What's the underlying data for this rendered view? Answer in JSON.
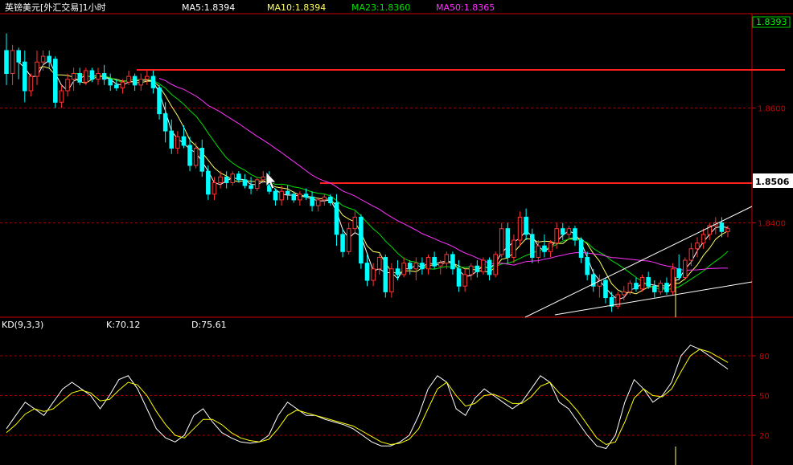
{
  "header": {
    "title": "英镑美元[外汇交易]1小时",
    "ma_labels": [
      {
        "text": "MA5:1.8394",
        "color": "#ffffff"
      },
      {
        "text": "MA10:1.8394",
        "color": "#ffff66"
      },
      {
        "text": "MA23:1.8360",
        "color": "#00e000"
      },
      {
        "text": "MA50:1.8365",
        "color": "#ff33ff"
      }
    ]
  },
  "kd_header": {
    "name": "KD(9,3,3)",
    "k_label": "K:70.12",
    "d_label": "D:75.61"
  },
  "price_axis": {
    "ticks": [
      "1.8600",
      "1.8400"
    ],
    "top_value": "1.8393",
    "highlight_value": "1.8506"
  },
  "kd_axis": {
    "ticks": [
      "80",
      "50",
      "20"
    ]
  },
  "colors": {
    "background": "#000000",
    "grid": "#990000",
    "axis": "#cc0000",
    "up_candle": "#ff3333",
    "down_candle": "#00ffff",
    "ma5": "#ffffff",
    "ma10": "#ffff66",
    "ma23": "#00e000",
    "ma50": "#ff33ff",
    "resistance": "#ff2020",
    "channel": "#ffffff",
    "k_line": "#ffffff",
    "d_line": "#ffff00"
  },
  "chart_data": [
    {
      "type": "candlestick",
      "title": "英镑美元[外汇交易]1小时",
      "ylim": [
        1.824,
        1.876
      ],
      "yticks": [
        1.86,
        1.84
      ],
      "candles": [
        [
          1.87,
          1.873,
          1.864,
          1.866
        ],
        [
          1.866,
          1.871,
          1.864,
          1.87
        ],
        [
          1.87,
          1.8705,
          1.865,
          1.868
        ],
        [
          1.868,
          1.87,
          1.861,
          1.863
        ],
        [
          1.863,
          1.866,
          1.862,
          1.8655
        ],
        [
          1.8655,
          1.87,
          1.864,
          1.868
        ],
        [
          1.868,
          1.87,
          1.8665,
          1.869
        ],
        [
          1.869,
          1.87,
          1.867,
          1.868
        ],
        [
          1.8685,
          1.869,
          1.86,
          1.861
        ],
        [
          1.861,
          1.864,
          1.86,
          1.863
        ],
        [
          1.863,
          1.866,
          1.862,
          1.865
        ],
        [
          1.865,
          1.867,
          1.863,
          1.866
        ],
        [
          1.866,
          1.867,
          1.864,
          1.8645
        ],
        [
          1.8645,
          1.867,
          1.864,
          1.8665
        ],
        [
          1.8665,
          1.867,
          1.8645,
          1.865
        ],
        [
          1.865,
          1.867,
          1.864,
          1.866
        ],
        [
          1.866,
          1.8675,
          1.864,
          1.865
        ],
        [
          1.865,
          1.866,
          1.863,
          1.864
        ],
        [
          1.864,
          1.865,
          1.863,
          1.8635
        ],
        [
          1.8635,
          1.865,
          1.8625,
          1.8645
        ],
        [
          1.8645,
          1.8665,
          1.864,
          1.8655
        ],
        [
          1.8655,
          1.866,
          1.863,
          1.864
        ],
        [
          1.864,
          1.866,
          1.863,
          1.865
        ],
        [
          1.865,
          1.8665,
          1.864,
          1.8655
        ],
        [
          1.8655,
          1.8665,
          1.8625,
          1.8635
        ],
        [
          1.8635,
          1.864,
          1.858,
          1.859
        ],
        [
          1.859,
          1.861,
          1.854,
          1.856
        ],
        [
          1.856,
          1.858,
          1.852,
          1.853
        ],
        [
          1.853,
          1.856,
          1.852,
          1.855
        ],
        [
          1.855,
          1.857,
          1.853,
          1.8535
        ],
        [
          1.8535,
          1.855,
          1.849,
          1.85
        ],
        [
          1.85,
          1.854,
          1.8495,
          1.853
        ],
        [
          1.853,
          1.8545,
          1.848,
          1.849
        ],
        [
          1.849,
          1.85,
          1.844,
          1.845
        ],
        [
          1.845,
          1.848,
          1.844,
          1.847
        ],
        [
          1.847,
          1.849,
          1.846,
          1.848
        ],
        [
          1.848,
          1.849,
          1.846,
          1.847
        ],
        [
          1.847,
          1.849,
          1.8465,
          1.8485
        ],
        [
          1.8485,
          1.849,
          1.847,
          1.8475
        ],
        [
          1.8475,
          1.8485,
          1.846,
          1.8465
        ],
        [
          1.8465,
          1.848,
          1.845,
          1.846
        ],
        [
          1.846,
          1.848,
          1.8455,
          1.8475
        ],
        [
          1.8475,
          1.849,
          1.847,
          1.848
        ],
        [
          1.848,
          1.849,
          1.845,
          1.8455
        ],
        [
          1.8455,
          1.846,
          1.843,
          1.844
        ],
        [
          1.844,
          1.8465,
          1.843,
          1.8455
        ],
        [
          1.8455,
          1.8465,
          1.844,
          1.845
        ],
        [
          1.845,
          1.8455,
          1.8435,
          1.844
        ],
        [
          1.844,
          1.8455,
          1.843,
          1.845
        ],
        [
          1.845,
          1.846,
          1.844,
          1.8445
        ],
        [
          1.8445,
          1.8455,
          1.842,
          1.843
        ],
        [
          1.843,
          1.8445,
          1.842,
          1.844
        ],
        [
          1.844,
          1.845,
          1.843,
          1.8445
        ],
        [
          1.8445,
          1.845,
          1.843,
          1.8435
        ],
        [
          1.8435,
          1.845,
          1.836,
          1.838
        ],
        [
          1.838,
          1.839,
          1.834,
          1.835
        ],
        [
          1.835,
          1.84,
          1.8345,
          1.839
        ],
        [
          1.839,
          1.842,
          1.838,
          1.841
        ],
        [
          1.841,
          1.8415,
          1.832,
          1.833
        ],
        [
          1.833,
          1.8345,
          1.829,
          1.83
        ],
        [
          1.83,
          1.833,
          1.829,
          1.832
        ],
        [
          1.832,
          1.8345,
          1.831,
          1.834
        ],
        [
          1.834,
          1.8345,
          1.827,
          1.828
        ],
        [
          1.828,
          1.833,
          1.827,
          1.832
        ],
        [
          1.832,
          1.8335,
          1.83,
          1.831
        ],
        [
          1.831,
          1.834,
          1.8305,
          1.833
        ],
        [
          1.833,
          1.8335,
          1.831,
          1.832
        ],
        [
          1.832,
          1.834,
          1.83,
          1.833
        ],
        [
          1.833,
          1.834,
          1.831,
          1.832
        ],
        [
          1.832,
          1.8345,
          1.831,
          1.834
        ],
        [
          1.834,
          1.835,
          1.832,
          1.8325
        ],
        [
          1.8325,
          1.8335,
          1.831,
          1.833
        ],
        [
          1.833,
          1.835,
          1.832,
          1.8345
        ],
        [
          1.8345,
          1.835,
          1.831,
          1.832
        ],
        [
          1.832,
          1.8335,
          1.828,
          1.829
        ],
        [
          1.829,
          1.832,
          1.828,
          1.831
        ],
        [
          1.831,
          1.833,
          1.83,
          1.8325
        ],
        [
          1.8325,
          1.8335,
          1.8305,
          1.8315
        ],
        [
          1.8315,
          1.834,
          1.831,
          1.8335
        ],
        [
          1.8335,
          1.834,
          1.83,
          1.831
        ],
        [
          1.831,
          1.835,
          1.8305,
          1.8345
        ],
        [
          1.8345,
          1.84,
          1.834,
          1.839
        ],
        [
          1.839,
          1.84,
          1.833,
          1.834
        ],
        [
          1.834,
          1.838,
          1.833,
          1.837
        ],
        [
          1.837,
          1.842,
          1.836,
          1.841
        ],
        [
          1.841,
          1.8425,
          1.837,
          1.838
        ],
        [
          1.838,
          1.839,
          1.833,
          1.834
        ],
        [
          1.834,
          1.837,
          1.833,
          1.836
        ],
        [
          1.836,
          1.838,
          1.834,
          1.835
        ],
        [
          1.835,
          1.837,
          1.834,
          1.8365
        ],
        [
          1.8365,
          1.84,
          1.8355,
          1.839
        ],
        [
          1.839,
          1.84,
          1.837,
          1.838
        ],
        [
          1.838,
          1.8395,
          1.837,
          1.839
        ],
        [
          1.839,
          1.8395,
          1.836,
          1.837
        ],
        [
          1.837,
          1.8375,
          1.833,
          1.834
        ],
        [
          1.834,
          1.835,
          1.83,
          1.831
        ],
        [
          1.831,
          1.832,
          1.828,
          1.829
        ],
        [
          1.829,
          1.831,
          1.827,
          1.83
        ],
        [
          1.83,
          1.8305,
          1.826,
          1.827
        ],
        [
          1.827,
          1.828,
          1.8245,
          1.8255
        ],
        [
          1.8255,
          1.828,
          1.825,
          1.8275
        ],
        [
          1.8275,
          1.829,
          1.8265,
          1.828
        ],
        [
          1.828,
          1.83,
          1.8275,
          1.8295
        ],
        [
          1.8295,
          1.8305,
          1.828,
          1.8285
        ],
        [
          1.8285,
          1.831,
          1.828,
          1.8305
        ],
        [
          1.8305,
          1.8315,
          1.8285,
          1.829
        ],
        [
          1.829,
          1.83,
          1.827,
          1.828
        ],
        [
          1.828,
          1.83,
          1.8275,
          1.8295
        ],
        [
          1.8295,
          1.8305,
          1.8275,
          1.828
        ],
        [
          1.828,
          1.833,
          1.8275,
          1.832
        ],
        [
          1.832,
          1.8345,
          1.83,
          1.8305
        ],
        [
          1.8305,
          1.834,
          1.83,
          1.8335
        ],
        [
          1.8335,
          1.8365,
          1.8325,
          1.8355
        ],
        [
          1.8355,
          1.8375,
          1.834,
          1.8365
        ],
        [
          1.8365,
          1.839,
          1.8355,
          1.838
        ],
        [
          1.838,
          1.84,
          1.837,
          1.8395
        ],
        [
          1.8395,
          1.841,
          1.838,
          1.84
        ],
        [
          1.84,
          1.841,
          1.8375,
          1.8385
        ],
        [
          1.8385,
          1.8395,
          1.8375,
          1.839
        ]
      ]
    },
    {
      "type": "line",
      "title": "KD(9,3,3)",
      "ylim": [
        0,
        100
      ],
      "yticks": [
        80,
        50,
        20
      ],
      "series": [
        {
          "name": "K",
          "values": [
            25,
            35,
            45,
            40,
            35,
            45,
            55,
            60,
            55,
            50,
            40,
            50,
            62,
            65,
            55,
            40,
            25,
            18,
            15,
            20,
            35,
            40,
            30,
            22,
            18,
            15,
            14,
            15,
            20,
            35,
            45,
            40,
            35,
            35,
            32,
            30,
            28,
            25,
            20,
            15,
            12,
            12,
            15,
            20,
            35,
            55,
            65,
            60,
            40,
            35,
            48,
            55,
            50,
            45,
            40,
            45,
            55,
            65,
            60,
            45,
            40,
            30,
            20,
            12,
            10,
            20,
            45,
            62,
            55,
            45,
            50,
            60,
            80,
            88,
            85,
            80,
            75,
            70
          ]
        },
        {
          "name": "D",
          "values": [
            22,
            28,
            36,
            40,
            38,
            40,
            46,
            52,
            54,
            52,
            46,
            47,
            54,
            60,
            58,
            50,
            38,
            28,
            20,
            18,
            25,
            32,
            32,
            28,
            22,
            18,
            16,
            15,
            17,
            25,
            35,
            39,
            37,
            35,
            33,
            31,
            29,
            27,
            23,
            19,
            15,
            13,
            14,
            17,
            25,
            40,
            55,
            60,
            50,
            42,
            44,
            50,
            51,
            48,
            44,
            44,
            49,
            57,
            60,
            52,
            46,
            38,
            28,
            18,
            13,
            15,
            30,
            48,
            55,
            50,
            49,
            55,
            68,
            80,
            85,
            83,
            79,
            75
          ]
        }
      ]
    }
  ]
}
